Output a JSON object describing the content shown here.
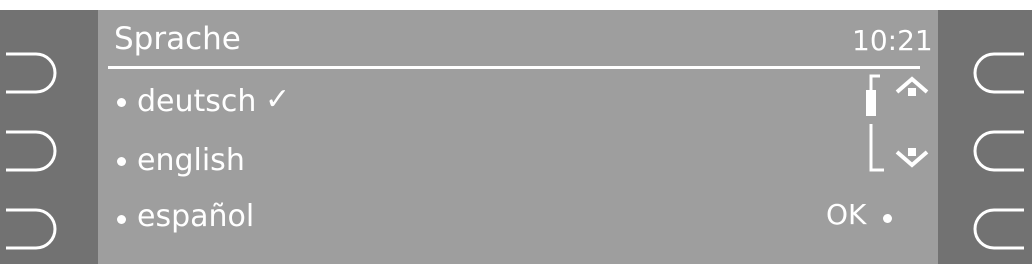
{
  "screen": {
    "title": "Sprache",
    "time": "10:21"
  },
  "languages": [
    {
      "label": "deutsch",
      "selected": true,
      "check_mark": "✓"
    },
    {
      "label": "english",
      "selected": false
    },
    {
      "label": "español",
      "selected": false
    }
  ],
  "ok_button": {
    "label": "OK"
  },
  "scrollbar": {
    "up_icon": "up-arrow-icon",
    "down_icon": "down-arrow-icon",
    "position": "top"
  },
  "softkeys": {
    "left": [
      "softkey-left-1",
      "softkey-left-2",
      "softkey-left-3"
    ],
    "right": [
      "softkey-right-1",
      "softkey-right-2",
      "softkey-right-3"
    ]
  },
  "colors": {
    "screen": "#9e9e9e",
    "frame": "#727272",
    "text": "#ffffff"
  }
}
